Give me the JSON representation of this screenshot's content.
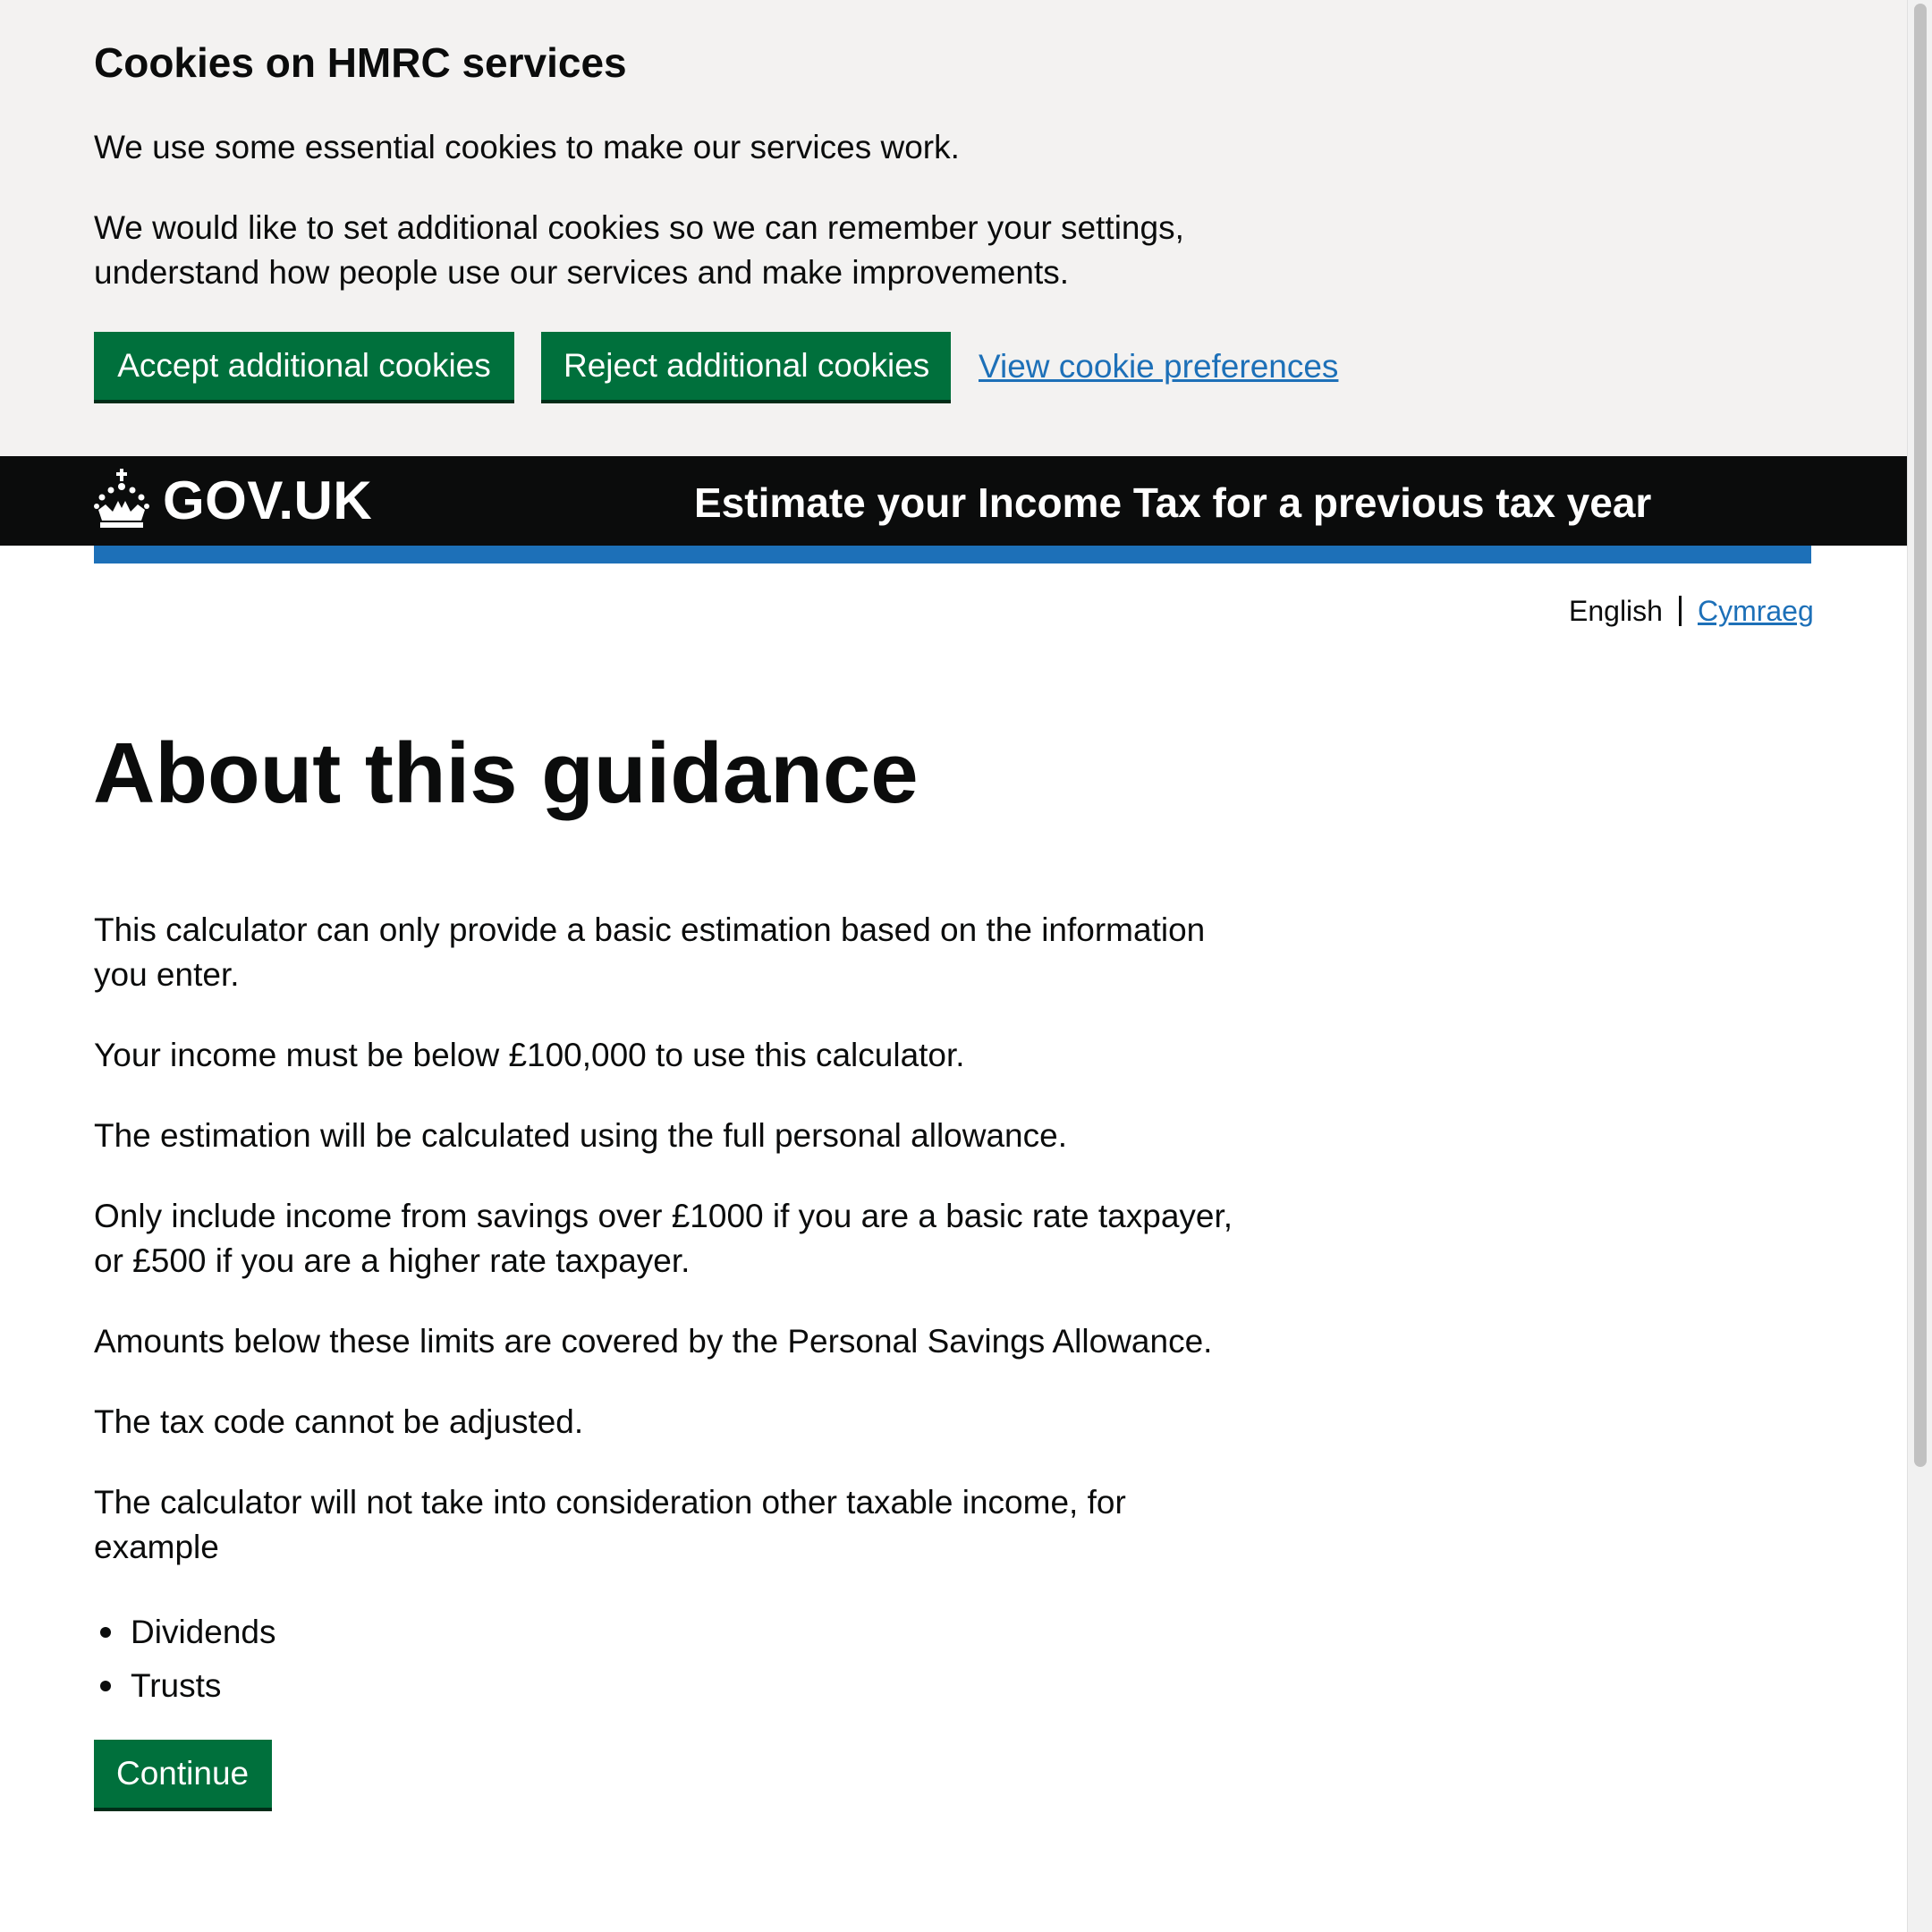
{
  "cookie_banner": {
    "title": "Cookies on HMRC services",
    "paragraph_1": "We use some essential cookies to make our services work.",
    "paragraph_2": "We would like to set additional cookies so we can remember your settings, understand how people use our services and make improvements.",
    "accept_label": "Accept additional cookies",
    "reject_label": "Reject additional cookies",
    "preferences_link": "View cookie preferences"
  },
  "header": {
    "logo_text": "GOV.UK",
    "logo_icon": "crown-icon",
    "service_name": "Estimate your Income Tax for a previous tax year"
  },
  "language": {
    "current": "English",
    "alternate": "Cymraeg"
  },
  "main": {
    "heading": "About this guidance",
    "paragraphs": [
      "This calculator can only provide a basic estimation based on the information you enter.",
      "Your income must be below £100,000 to use this calculator.",
      "The estimation will be calculated using the full personal allowance.",
      "Only include income from savings over £1000 if you are a basic rate taxpayer, or £500 if you are a higher rate taxpayer.",
      "Amounts below these limits are covered by the Personal Savings Allowance.",
      "The tax code cannot be adjusted.",
      "The calculator will not take into consideration other taxable income, for example"
    ],
    "list_items": [
      "Dividends",
      "Trusts"
    ],
    "continue_label": "Continue"
  },
  "colors": {
    "button_green": "#00703c",
    "link_blue": "#1d70b8",
    "header_black": "#0b0c0c",
    "banner_grey": "#f3f2f1"
  }
}
